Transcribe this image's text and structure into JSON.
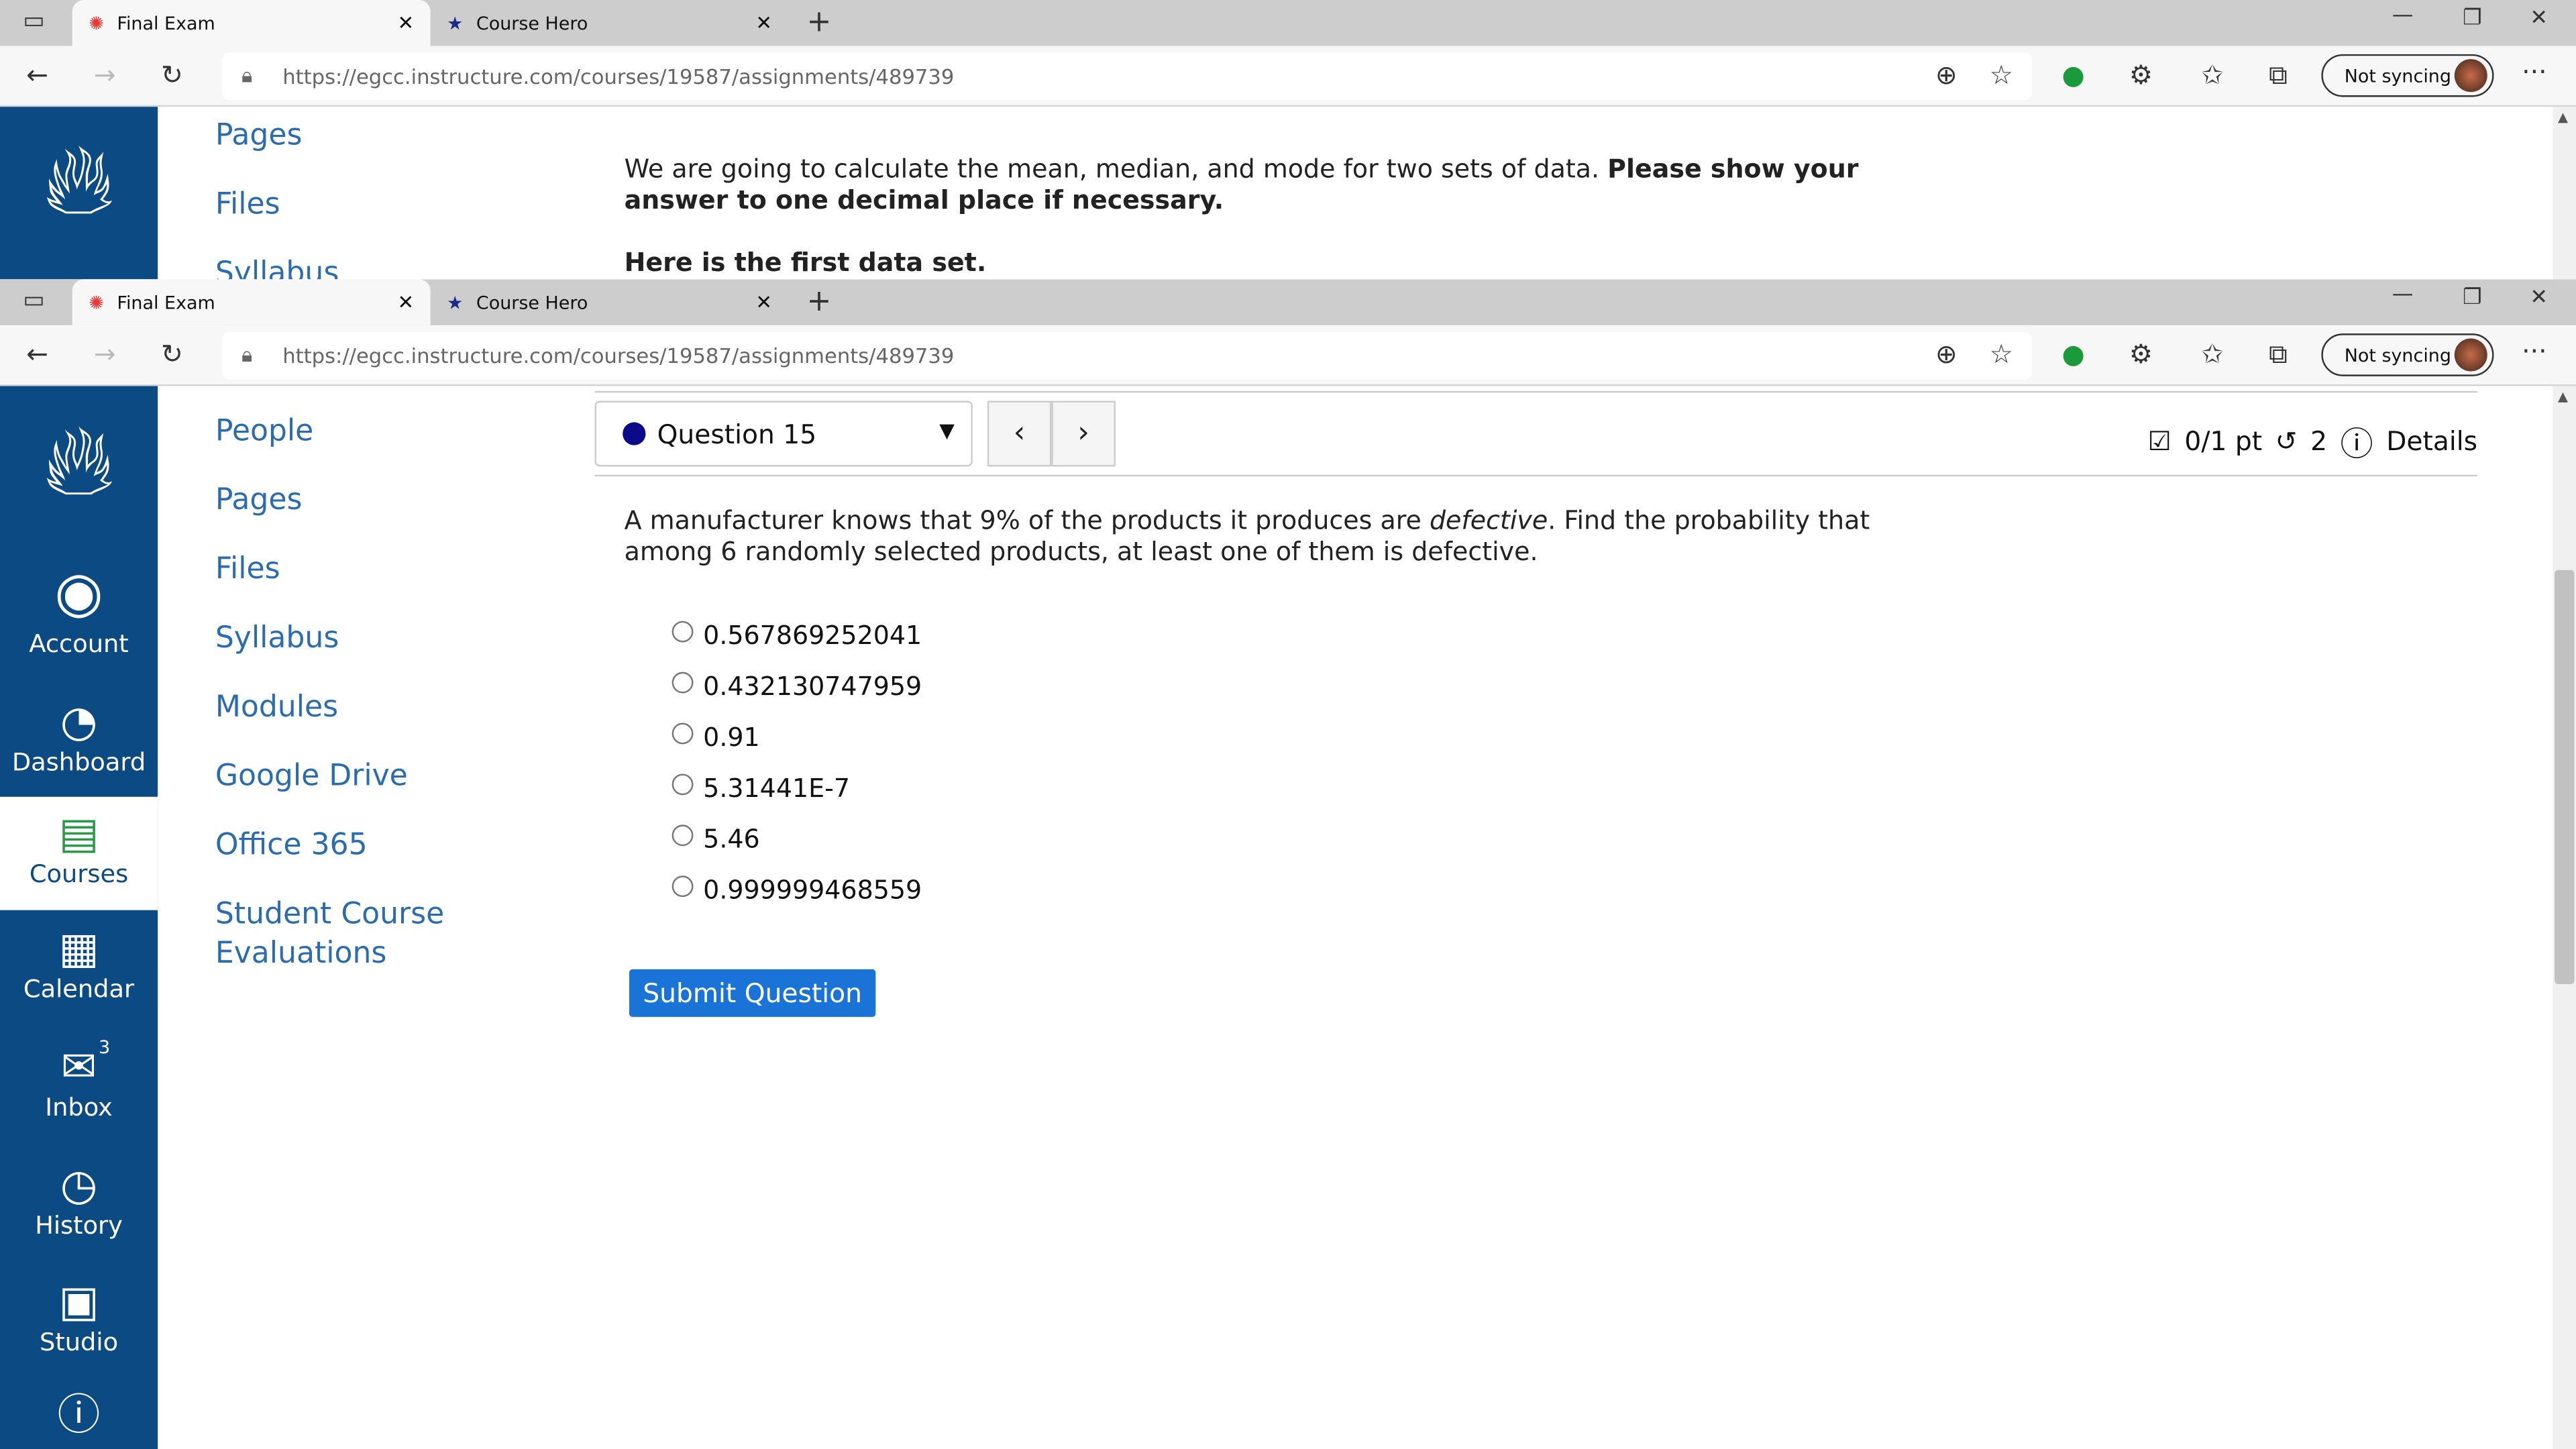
{
  "browser": {
    "tabs": [
      {
        "title": "Final Exam",
        "icon": "canvas-logo-icon",
        "active": true
      },
      {
        "title": "Course Hero",
        "icon": "course-hero-icon",
        "active": false
      }
    ],
    "url_host": "https://egcc.instructure.com",
    "url_path": "/courses/19587/assignments/489739",
    "sync_label": "Not syncing",
    "close_glyph": "✕",
    "new_tab_glyph": "+",
    "menu_glyph": "···"
  },
  "back_window": {
    "course_nav": [
      "Pages",
      "Files",
      "Syllabus"
    ],
    "text_normal": "We are going to calculate the mean, median, and mode for two sets of data. ",
    "text_bold": "Please show your answer to one decimal place if necessary.",
    "text_line2": "Here is the first data set."
  },
  "global_nav": [
    {
      "label": "Account",
      "icon": "account-icon"
    },
    {
      "label": "Dashboard",
      "icon": "dashboard-icon"
    },
    {
      "label": "Courses",
      "icon": "courses-icon",
      "active": true
    },
    {
      "label": "Calendar",
      "icon": "calendar-icon"
    },
    {
      "label": "Inbox",
      "icon": "inbox-icon",
      "badge": "3"
    },
    {
      "label": "History",
      "icon": "history-icon"
    },
    {
      "label": "Studio",
      "icon": "studio-icon"
    },
    {
      "label": "",
      "icon": "help-icon"
    }
  ],
  "course_nav": [
    "People",
    "Pages",
    "Files",
    "Syllabus",
    "Modules",
    "Google Drive",
    "Office 365",
    "Student Course Evaluations"
  ],
  "question": {
    "selector": "Question 15",
    "score": "0/1 pt",
    "attempts": "2",
    "details": "Details",
    "text_a": "A manufacturer knows that 9% of the products it produces are ",
    "text_em": "defective",
    "text_b": ". Find the probability that among 6 randomly selected products, at least one of them is defective.",
    "options": [
      "0.567869252041",
      "0.432130747959",
      "0.91",
      "5.31441E-7",
      "5.46",
      "0.999999468559"
    ],
    "submit": "Submit Question"
  },
  "colors": {
    "nav": "#0b4a82",
    "link": "#2b6cb0",
    "submit": "#1a73d6"
  }
}
